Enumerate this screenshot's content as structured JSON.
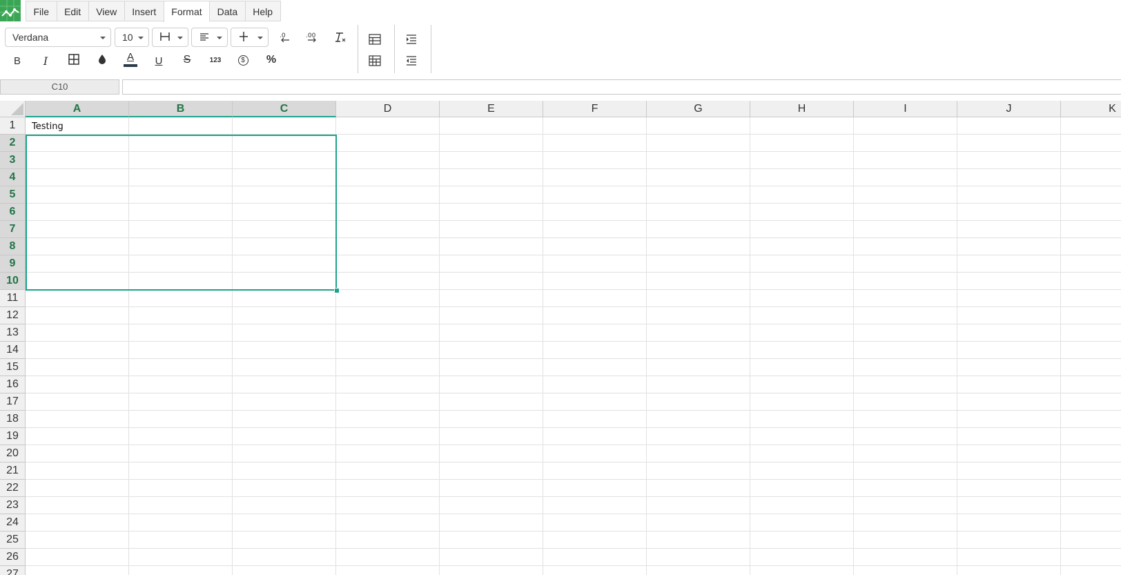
{
  "menu": {
    "items": [
      {
        "label": "File",
        "active": false
      },
      {
        "label": "Edit",
        "active": false
      },
      {
        "label": "View",
        "active": false
      },
      {
        "label": "Insert",
        "active": false
      },
      {
        "label": "Format",
        "active": true
      },
      {
        "label": "Data",
        "active": false
      },
      {
        "label": "Help",
        "active": false
      }
    ]
  },
  "toolbar": {
    "font_family": "Verdana",
    "font_size": "10",
    "bold_label": "B",
    "italic_label": "I",
    "underline_label": "U",
    "strike_label": "S",
    "number_format_label": "123",
    "currency_label": "$",
    "percent_label": "%",
    "text_color": "#2b3a4a"
  },
  "formula_bar": {
    "name_box": "C10",
    "value": ""
  },
  "grid": {
    "columns": [
      "A",
      "B",
      "C",
      "D",
      "E",
      "F",
      "G",
      "H",
      "I",
      "J",
      "K"
    ],
    "selected_columns": [
      "A",
      "B",
      "C"
    ],
    "rows": [
      "1",
      "2",
      "3",
      "4",
      "5",
      "6",
      "7",
      "8",
      "9",
      "10",
      "11",
      "12",
      "13",
      "14",
      "15",
      "16",
      "17",
      "18",
      "19",
      "20",
      "21",
      "22",
      "23",
      "24",
      "25",
      "26",
      "27"
    ],
    "selected_rows": [
      "2",
      "3",
      "4",
      "5",
      "6",
      "7",
      "8",
      "9",
      "10"
    ],
    "cells": {
      "A1": "Testing"
    }
  },
  "colors": {
    "accent": "#1aa38a",
    "header_selected_text": "#217346",
    "logo": "#3aa655"
  }
}
